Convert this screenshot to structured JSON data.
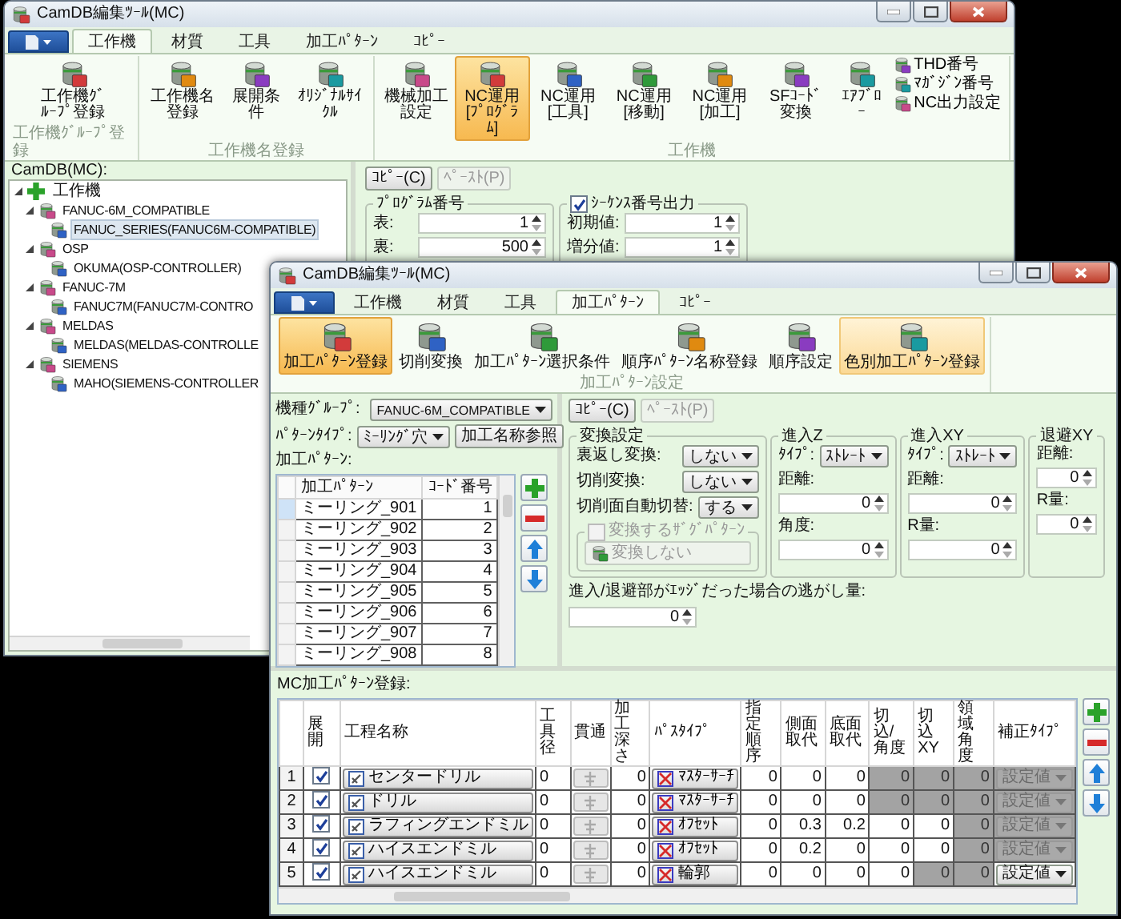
{
  "back_window": {
    "title": "CamDB編集ﾂｰﾙ(MC)",
    "tabs": [
      {
        "label": "工作機",
        "selected": true
      },
      {
        "label": "材質",
        "selected": false
      },
      {
        "label": "工具",
        "selected": false
      },
      {
        "label": "加工ﾊﾟﾀｰﾝ",
        "selected": false
      },
      {
        "label": "ｺﾋﾟｰ",
        "selected": false
      }
    ],
    "ribbon": [
      {
        "label": "工作機ｸﾞﾙｰﾌﾟ登録",
        "buttons": [
          {
            "label": "工作機ｸﾞﾙｰﾌﾟ登録",
            "selected": false
          }
        ]
      },
      {
        "label": "工作機名登録",
        "buttons": [
          {
            "label": "工作機名登録",
            "selected": false
          },
          {
            "label": "展開条件",
            "selected": false
          },
          {
            "label": "ｵﾘｼﾞﾅﾙｻｲｸﾙ",
            "selected": false
          }
        ]
      },
      {
        "label": "工作機",
        "buttons": [
          {
            "label": "機械加工設定",
            "selected": false
          },
          {
            "label": "NC運用[ﾌﾟﾛｸﾞﾗﾑ]",
            "selected": true
          },
          {
            "label": "NC運用[工具]",
            "selected": false
          },
          {
            "label": "NC運用[移動]",
            "selected": false
          },
          {
            "label": "NC運用[加工]",
            "selected": false
          },
          {
            "label": "SFｺｰﾄﾞ変換",
            "selected": false
          },
          {
            "label": "ｴｱﾌﾞﾛｰ",
            "selected": false
          }
        ],
        "small_buttons": [
          {
            "label": "THD番号"
          },
          {
            "label": "ﾏｶﾞｼﾞﾝ番号"
          },
          {
            "label": "NC出力設定"
          }
        ]
      }
    ],
    "tree_label": "CamDB(MC):",
    "tree": [
      {
        "label": "工作機",
        "expanded": true,
        "selected": false,
        "children": [
          {
            "label": "FANUC-6M_COMPATIBLE",
            "expanded": true,
            "selected": false,
            "children": [
              {
                "label": "FANUC_SERIES(FANUC6M-COMPATIBLE)",
                "selected": true
              }
            ]
          },
          {
            "label": "OSP",
            "expanded": true,
            "selected": false,
            "children": [
              {
                "label": "OKUMA(OSP-CONTROLLER)",
                "selected": false
              }
            ]
          },
          {
            "label": "FANUC-7M",
            "expanded": true,
            "selected": false,
            "children": [
              {
                "label": "FANUC7M(FANUC7M-CONTRO",
                "selected": false
              }
            ]
          },
          {
            "label": "MELDAS",
            "expanded": true,
            "selected": false,
            "children": [
              {
                "label": "MELDAS(MELDAS-CONTROLLE",
                "selected": false
              }
            ]
          },
          {
            "label": "SIEMENS",
            "expanded": true,
            "selected": false,
            "children": [
              {
                "label": "MAHO(SIEMENS-CONTROLLER",
                "selected": false
              }
            ]
          }
        ]
      }
    ],
    "copy_button": {
      "label": "ｺﾋﾟｰ(C)",
      "disabled": false
    },
    "paste_button": {
      "label": "ﾍﾟｰｽﾄ(P)",
      "disabled": true
    },
    "program_number": {
      "title": "ﾌﾟﾛｸﾞﾗﾑ番号",
      "fields": [
        {
          "label": "表:",
          "value": "1"
        },
        {
          "label": "裏:",
          "value": "500"
        }
      ]
    },
    "sequence_output": {
      "title": "ｼｰｹﾝｽ番号出力",
      "checked": true,
      "fields": [
        {
          "label": "初期値:",
          "value": "1"
        },
        {
          "label": "増分値:",
          "value": "1"
        }
      ]
    }
  },
  "front_window": {
    "title": "CamDB編集ﾂｰﾙ(MC)",
    "tabs": [
      {
        "label": "工作機",
        "selected": false
      },
      {
        "label": "材質",
        "selected": false
      },
      {
        "label": "工具",
        "selected": false
      },
      {
        "label": "加工ﾊﾟﾀｰﾝ",
        "selected": true
      },
      {
        "label": "ｺﾋﾟｰ",
        "selected": false
      }
    ],
    "ribbon": [
      {
        "label": "加工ﾊﾟﾀｰﾝ設定",
        "buttons": [
          {
            "label": "加工ﾊﾟﾀｰﾝ登録",
            "selected": true,
            "hovered": false
          },
          {
            "label": "切削変換",
            "selected": false,
            "hovered": false
          },
          {
            "label": "加工ﾊﾟﾀｰﾝ選択条件",
            "selected": false,
            "hovered": false
          },
          {
            "label": "順序ﾊﾟﾀｰﾝ名称登録",
            "selected": false,
            "hovered": false
          },
          {
            "label": "順序設定",
            "selected": false,
            "hovered": false
          },
          {
            "label": "色別加工ﾊﾟﾀｰﾝ登録",
            "selected": false,
            "hovered": true
          }
        ]
      }
    ],
    "machine_group": {
      "label": "機種ｸﾞﾙｰﾌﾟ:",
      "value": "FANUC-6M_COMPATIBLE"
    },
    "pattern_type": {
      "label": "ﾊﾟﾀｰﾝﾀｲﾌﾟ:",
      "value": "ﾐｰﾘﾝｸﾞ穴"
    },
    "name_reference_button": "加工名称参照",
    "pattern_list": {
      "label": "加工ﾊﾟﾀｰﾝ:",
      "columns": [
        "加工ﾊﾟﾀｰﾝ",
        "ｺｰﾄﾞ番号"
      ],
      "rows": [
        {
          "name": "ミーリング_901",
          "code": "1",
          "selected": true
        },
        {
          "name": "ミーリング_902",
          "code": "2",
          "selected": false
        },
        {
          "name": "ミーリング_903",
          "code": "3",
          "selected": false
        },
        {
          "name": "ミーリング_904",
          "code": "4",
          "selected": false
        },
        {
          "name": "ミーリング_905",
          "code": "5",
          "selected": false
        },
        {
          "name": "ミーリング_906",
          "code": "6",
          "selected": false
        },
        {
          "name": "ミーリング_907",
          "code": "7",
          "selected": false
        },
        {
          "name": "ミーリング_908",
          "code": "8",
          "selected": false
        }
      ]
    },
    "copy_button": {
      "label": "ｺﾋﾟｰ(C)",
      "disabled": false
    },
    "paste_button": {
      "label": "ﾍﾟｰｽﾄ(P)",
      "disabled": true
    },
    "conversion": {
      "title": "変換設定",
      "fields": [
        {
          "label": "裏返し変換:",
          "value": "しない"
        },
        {
          "label": "切削変換:",
          "value": "しない"
        },
        {
          "label": "切削面自動切替:",
          "value": "する"
        }
      ],
      "zigzag": {
        "label": "変換するｻﾞｸﾞﾊﾟﾀｰﾝ",
        "checked": false,
        "disabled": true
      },
      "zigzag_button": {
        "label": "変換しない",
        "disabled": true
      }
    },
    "approach_z": {
      "title": "進入Z",
      "type": {
        "label": "ﾀｲﾌﾟ:",
        "value": "ｽﾄﾚｰﾄ"
      },
      "fields": [
        {
          "label": "距離:",
          "value": "0"
        },
        {
          "label": "角度:",
          "value": "0"
        }
      ]
    },
    "approach_xy": {
      "title": "進入XY",
      "type": {
        "label": "ﾀｲﾌﾟ:",
        "value": "ｽﾄﾚｰﾄ"
      },
      "fields": [
        {
          "label": "距離:",
          "value": "0"
        },
        {
          "label": "R量:",
          "value": "0"
        }
      ]
    },
    "retract_xy": {
      "title": "退避XY",
      "fields": [
        {
          "label": "距離:",
          "value": "0"
        },
        {
          "label": "R量:",
          "value": "0"
        }
      ]
    },
    "edge_escape": {
      "label": "進入/退避部がｴｯｼﾞだった場合の逃がし量:",
      "value": "0"
    },
    "process_table": {
      "label": "MC加工ﾊﾟﾀｰﾝ登録:",
      "columns": [
        "展開",
        "工程名称",
        "工具径",
        "貫通",
        "加工深さ",
        "ﾊﾟｽﾀｲﾌﾟ",
        "指定順序",
        "側面取代",
        "底面取代",
        "切込/角度",
        "切込XY",
        "領域角度",
        "補正ﾀｲﾌﾟ"
      ],
      "rows": [
        {
          "number": "1",
          "expanded": true,
          "name": "センタードリル",
          "tool_diameter": "0",
          "through": {
            "disabled": true
          },
          "depth": "0",
          "path_type": "ﾏｽﾀｰｻｰﾁ",
          "order": "0",
          "side_stock": "0",
          "bottom_stock": "0",
          "cut_angle": {
            "value": "0",
            "disabled": true
          },
          "cut_xy": {
            "value": "0",
            "disabled": true
          },
          "area_angle": {
            "value": "0",
            "disabled": true
          },
          "correction": {
            "value": "設定値",
            "disabled": true
          }
        },
        {
          "number": "2",
          "expanded": true,
          "name": "ドリル",
          "tool_diameter": "0",
          "through": {
            "disabled": true
          },
          "depth": "0",
          "path_type": "ﾏｽﾀｰｻｰﾁ",
          "order": "0",
          "side_stock": "0",
          "bottom_stock": "0",
          "cut_angle": {
            "value": "0",
            "disabled": true
          },
          "cut_xy": {
            "value": "0",
            "disabled": true
          },
          "area_angle": {
            "value": "0",
            "disabled": true
          },
          "correction": {
            "value": "設定値",
            "disabled": true
          }
        },
        {
          "number": "3",
          "expanded": true,
          "name": "ラフィングエンドミル",
          "tool_diameter": "0",
          "through": {
            "disabled": true
          },
          "depth": "0",
          "path_type": "ｵﾌｾｯﾄ",
          "order": "0",
          "side_stock": "0.3",
          "bottom_stock": "0.2",
          "cut_angle": {
            "value": "0",
            "disabled": false
          },
          "cut_xy": {
            "value": "0",
            "disabled": false
          },
          "area_angle": {
            "value": "0",
            "disabled": true
          },
          "correction": {
            "value": "設定値",
            "disabled": true
          }
        },
        {
          "number": "4",
          "expanded": true,
          "name": "ハイスエンドミル",
          "tool_diameter": "0",
          "through": {
            "disabled": true
          },
          "depth": "0",
          "path_type": "ｵﾌｾｯﾄ",
          "order": "0",
          "side_stock": "0.2",
          "bottom_stock": "0",
          "cut_angle": {
            "value": "0",
            "disabled": false
          },
          "cut_xy": {
            "value": "0",
            "disabled": false
          },
          "area_angle": {
            "value": "0",
            "disabled": true
          },
          "correction": {
            "value": "設定値",
            "disabled": true
          }
        },
        {
          "number": "5",
          "expanded": true,
          "name": "ハイスエンドミル",
          "tool_diameter": "0",
          "through": {
            "disabled": true
          },
          "depth": "0",
          "path_type": "輪郭",
          "order": "0",
          "side_stock": "0",
          "bottom_stock": "0",
          "cut_angle": {
            "value": "0",
            "disabled": false
          },
          "cut_xy": {
            "value": "0",
            "disabled": true
          },
          "area_angle": {
            "value": "0",
            "disabled": true
          },
          "correction": {
            "value": "設定値",
            "disabled": false
          }
        }
      ]
    }
  }
}
